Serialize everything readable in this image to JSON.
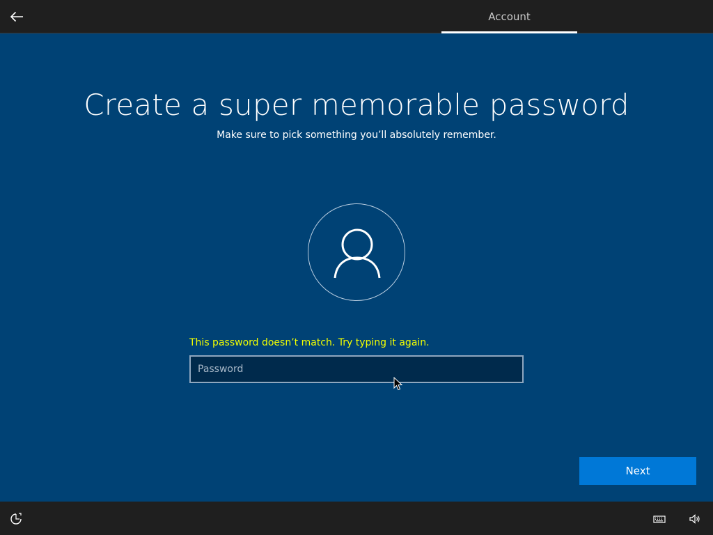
{
  "header": {
    "tab_label": "Account",
    "back_icon": "arrow-left-icon"
  },
  "main": {
    "title": "Create a super memorable password",
    "subtitle": "Make sure to pick something you’ll absolutely remember.",
    "avatar_icon": "user-icon",
    "error_message": "This password doesn’t match. Try typing it again.",
    "password_placeholder": "Password",
    "password_value": "",
    "next_label": "Next"
  },
  "footer": {
    "icons": [
      "ease-of-access-icon",
      "keyboard-icon",
      "volume-icon"
    ]
  },
  "colors": {
    "background": "#004275",
    "bar": "#1f1f1f",
    "accent": "#0078d7",
    "error": "#f2ff00"
  }
}
